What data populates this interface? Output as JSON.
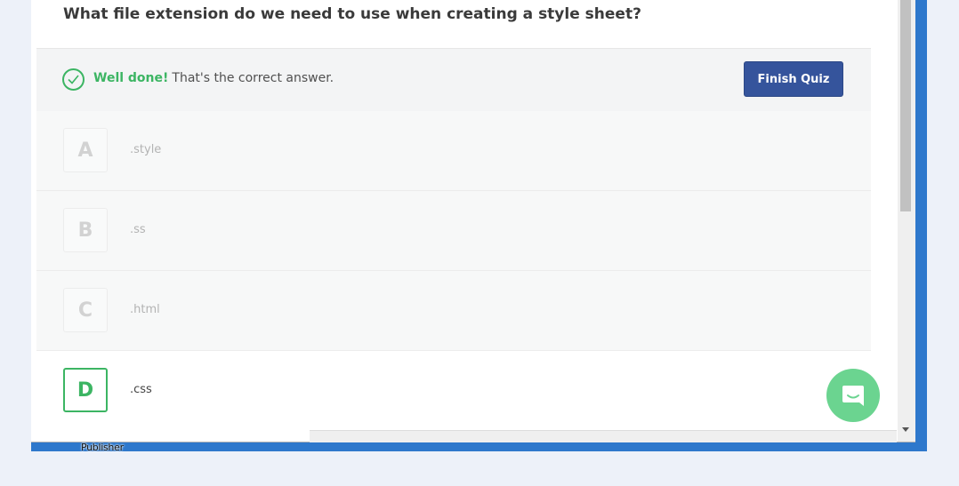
{
  "quiz": {
    "question": "What file extension do we need to use when creating a style sheet?",
    "feedback": {
      "status_icon": "check-circle-icon",
      "strong": "Well done!",
      "message": "That's the correct answer.",
      "color": "#3cb563"
    },
    "finish_button": "Finish Quiz",
    "options": [
      {
        "letter": "A",
        "text": ".style",
        "selected": false
      },
      {
        "letter": "B",
        "text": ".ss",
        "selected": false
      },
      {
        "letter": "C",
        "text": ".html",
        "selected": false
      },
      {
        "letter": "D",
        "text": ".css",
        "selected": true
      }
    ]
  },
  "chat_widget": {
    "icon": "chat-bubble-icon",
    "color": "#6bd490"
  },
  "taskbar": {
    "publisher_label": "Publisher"
  },
  "colors": {
    "accent": "#35549c",
    "success": "#3cb563",
    "desktop": "#2e78cc"
  }
}
